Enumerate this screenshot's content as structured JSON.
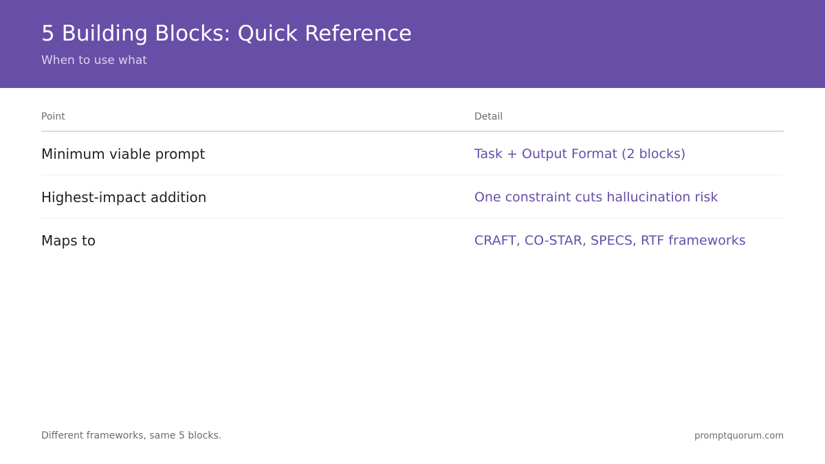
{
  "header": {
    "title": "5 Building Blocks: Quick Reference",
    "subtitle": "When to use what"
  },
  "table": {
    "columns": [
      "Point",
      "Detail"
    ],
    "rows": [
      {
        "point": "Minimum viable prompt",
        "detail": "Task + Output Format (2 blocks)"
      },
      {
        "point": "Highest-impact addition",
        "detail": "One constraint cuts hallucination risk"
      },
      {
        "point": "Maps to",
        "detail": "CRAFT, CO-STAR, SPECS, RTF frameworks"
      }
    ]
  },
  "footer": {
    "note": "Different frameworks, same 5 blocks.",
    "brand": "promptquorum.com"
  },
  "colors": {
    "header_background": "#674ea7",
    "accent": "#674ea7"
  }
}
